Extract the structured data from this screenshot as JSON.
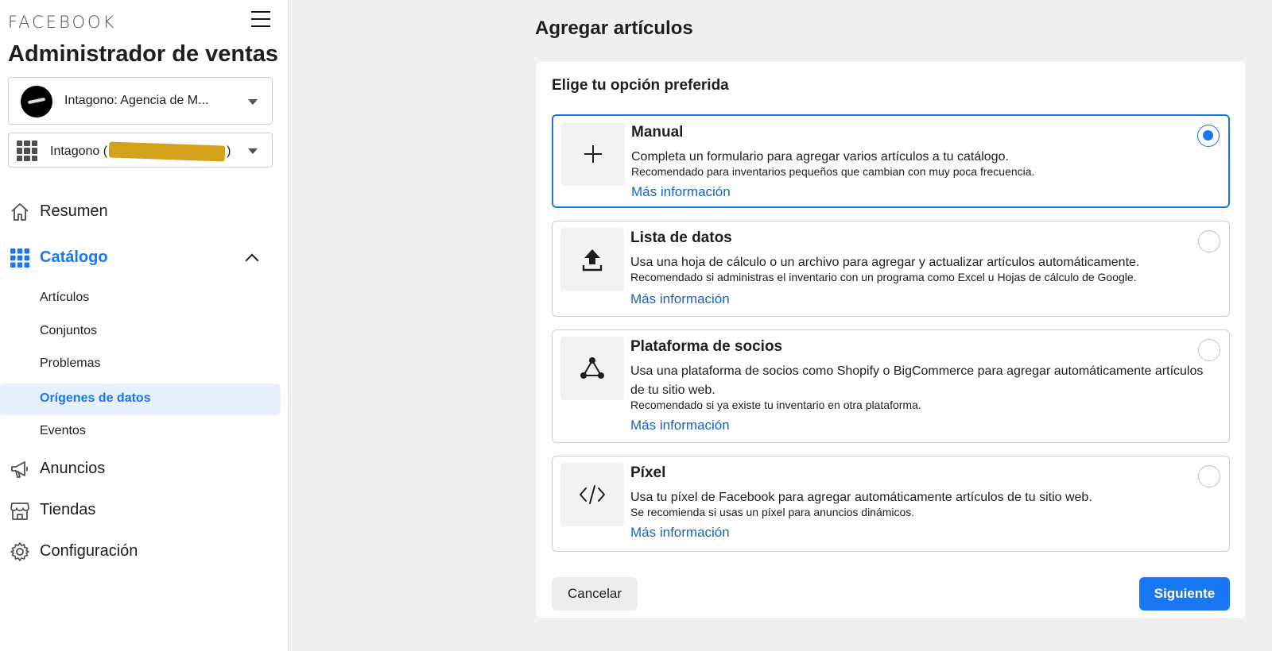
{
  "sidebar": {
    "brand": "FACEBOOK",
    "app_title": "Administrador de ventas",
    "business_selector": {
      "label": "Intagono: Agencia de M..."
    },
    "catalog_selector": {
      "prefix": "Intagono (",
      "suffix": ")"
    },
    "nav": {
      "summary": "Resumen",
      "catalog": "Catálogo",
      "catalog_sub": [
        "Artículos",
        "Conjuntos",
        "Problemas",
        "Orígenes de datos",
        "Eventos"
      ],
      "ads": "Anuncios",
      "shops": "Tiendas",
      "settings": "Configuración"
    },
    "active_color": "#1877f2"
  },
  "main": {
    "title": "Agregar artículos",
    "heading": "Elige tu opción preferida",
    "options": [
      {
        "title": "Manual",
        "description": "Completa un formulario para agregar varios artículos a tu catálogo.",
        "recommendation": "Recomendado para inventarios pequeños que cambian con muy poca frecuencia.",
        "link": "Más información",
        "icon": "plus-icon",
        "selected": true
      },
      {
        "title": "Lista de datos",
        "description": "Usa una hoja de cálculo o un archivo para agregar y actualizar artículos automáticamente.",
        "recommendation": "Recomendado si administras el inventario con un programa como Excel u Hojas de cálculo de Google.",
        "link": "Más información",
        "icon": "upload-icon",
        "selected": false
      },
      {
        "title": "Plataforma de socios",
        "description": "Usa una plataforma de socios como Shopify o BigCommerce para agregar automáticamente artículos de tu sitio web.",
        "recommendation": "Recomendado si ya existe tu inventario en otra plataforma.",
        "link": "Más información",
        "icon": "partner-network-icon",
        "selected": false
      },
      {
        "title": "Píxel",
        "description": "Usa tu píxel de Facebook para agregar automáticamente artículos de tu sitio web.",
        "recommendation": "Se recomienda si usas un píxel para anuncios dinámicos.",
        "link": "Más información",
        "icon": "code-icon",
        "selected": false
      }
    ],
    "cancel_label": "Cancelar",
    "next_label": "Siguiente"
  }
}
